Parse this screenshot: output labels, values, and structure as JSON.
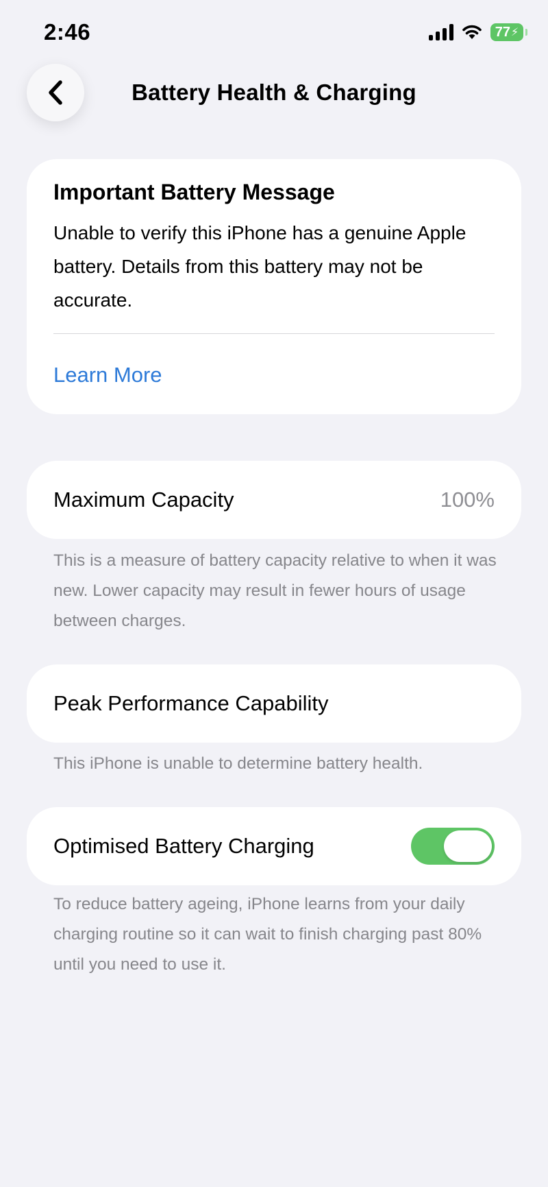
{
  "status_bar": {
    "time": "2:46",
    "battery_level": "77",
    "battery_color": "#5ec565",
    "icons": [
      "cellular-signal-icon",
      "wifi-icon",
      "battery-charging-icon"
    ]
  },
  "nav": {
    "back_icon": "chevron-left-icon",
    "title": "Battery Health & Charging"
  },
  "battery_message": {
    "heading": "Important Battery Message",
    "body": "Unable to verify this iPhone has a genuine Apple battery. Details from this battery may not be accurate.",
    "link_label": "Learn More",
    "link_color": "#2d7ad8"
  },
  "maximum_capacity": {
    "label": "Maximum Capacity",
    "value": "100%",
    "description": "This is a measure of battery capacity relative to when it was new. Lower capacity may result in fewer hours of usage between charges."
  },
  "peak_performance": {
    "label": "Peak Performance Capability",
    "description": "This iPhone is unable to determine battery health."
  },
  "optimised_charging": {
    "label": "Optimised Battery Charging",
    "enabled": true,
    "toggle_color": "#5ec565",
    "description": "To reduce battery ageing, iPhone learns from your daily charging routine so it can wait to finish charging past 80% until you need to use it."
  }
}
